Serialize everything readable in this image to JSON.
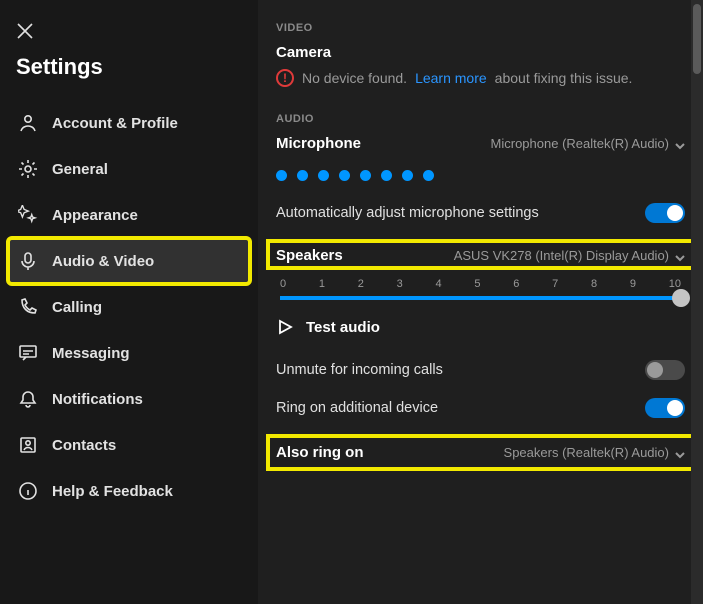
{
  "title": "Settings",
  "nav": [
    {
      "label": "Account & Profile"
    },
    {
      "label": "General"
    },
    {
      "label": "Appearance"
    },
    {
      "label": "Audio & Video"
    },
    {
      "label": "Calling"
    },
    {
      "label": "Messaging"
    },
    {
      "label": "Notifications"
    },
    {
      "label": "Contacts"
    },
    {
      "label": "Help & Feedback"
    }
  ],
  "video": {
    "section": "VIDEO",
    "camera_label": "Camera",
    "error_pre": "No device found.",
    "error_link": "Learn more",
    "error_post": "about fixing this issue."
  },
  "audio": {
    "section": "AUDIO",
    "mic_label": "Microphone",
    "mic_device": "Microphone (Realtek(R) Audio)",
    "auto_adjust": "Automatically adjust microphone settings",
    "speakers_label": "Speakers",
    "speakers_device": "ASUS VK278 (Intel(R) Display Audio)",
    "slider": {
      "ticks": [
        "0",
        "1",
        "2",
        "3",
        "4",
        "5",
        "6",
        "7",
        "8",
        "9",
        "10"
      ],
      "value_pct": 100
    },
    "test_audio": "Test audio",
    "unmute": "Unmute for incoming calls",
    "ring_additional": "Ring on additional device",
    "also_ring_label": "Also ring on",
    "also_ring_device": "Speakers (Realtek(R) Audio)"
  }
}
